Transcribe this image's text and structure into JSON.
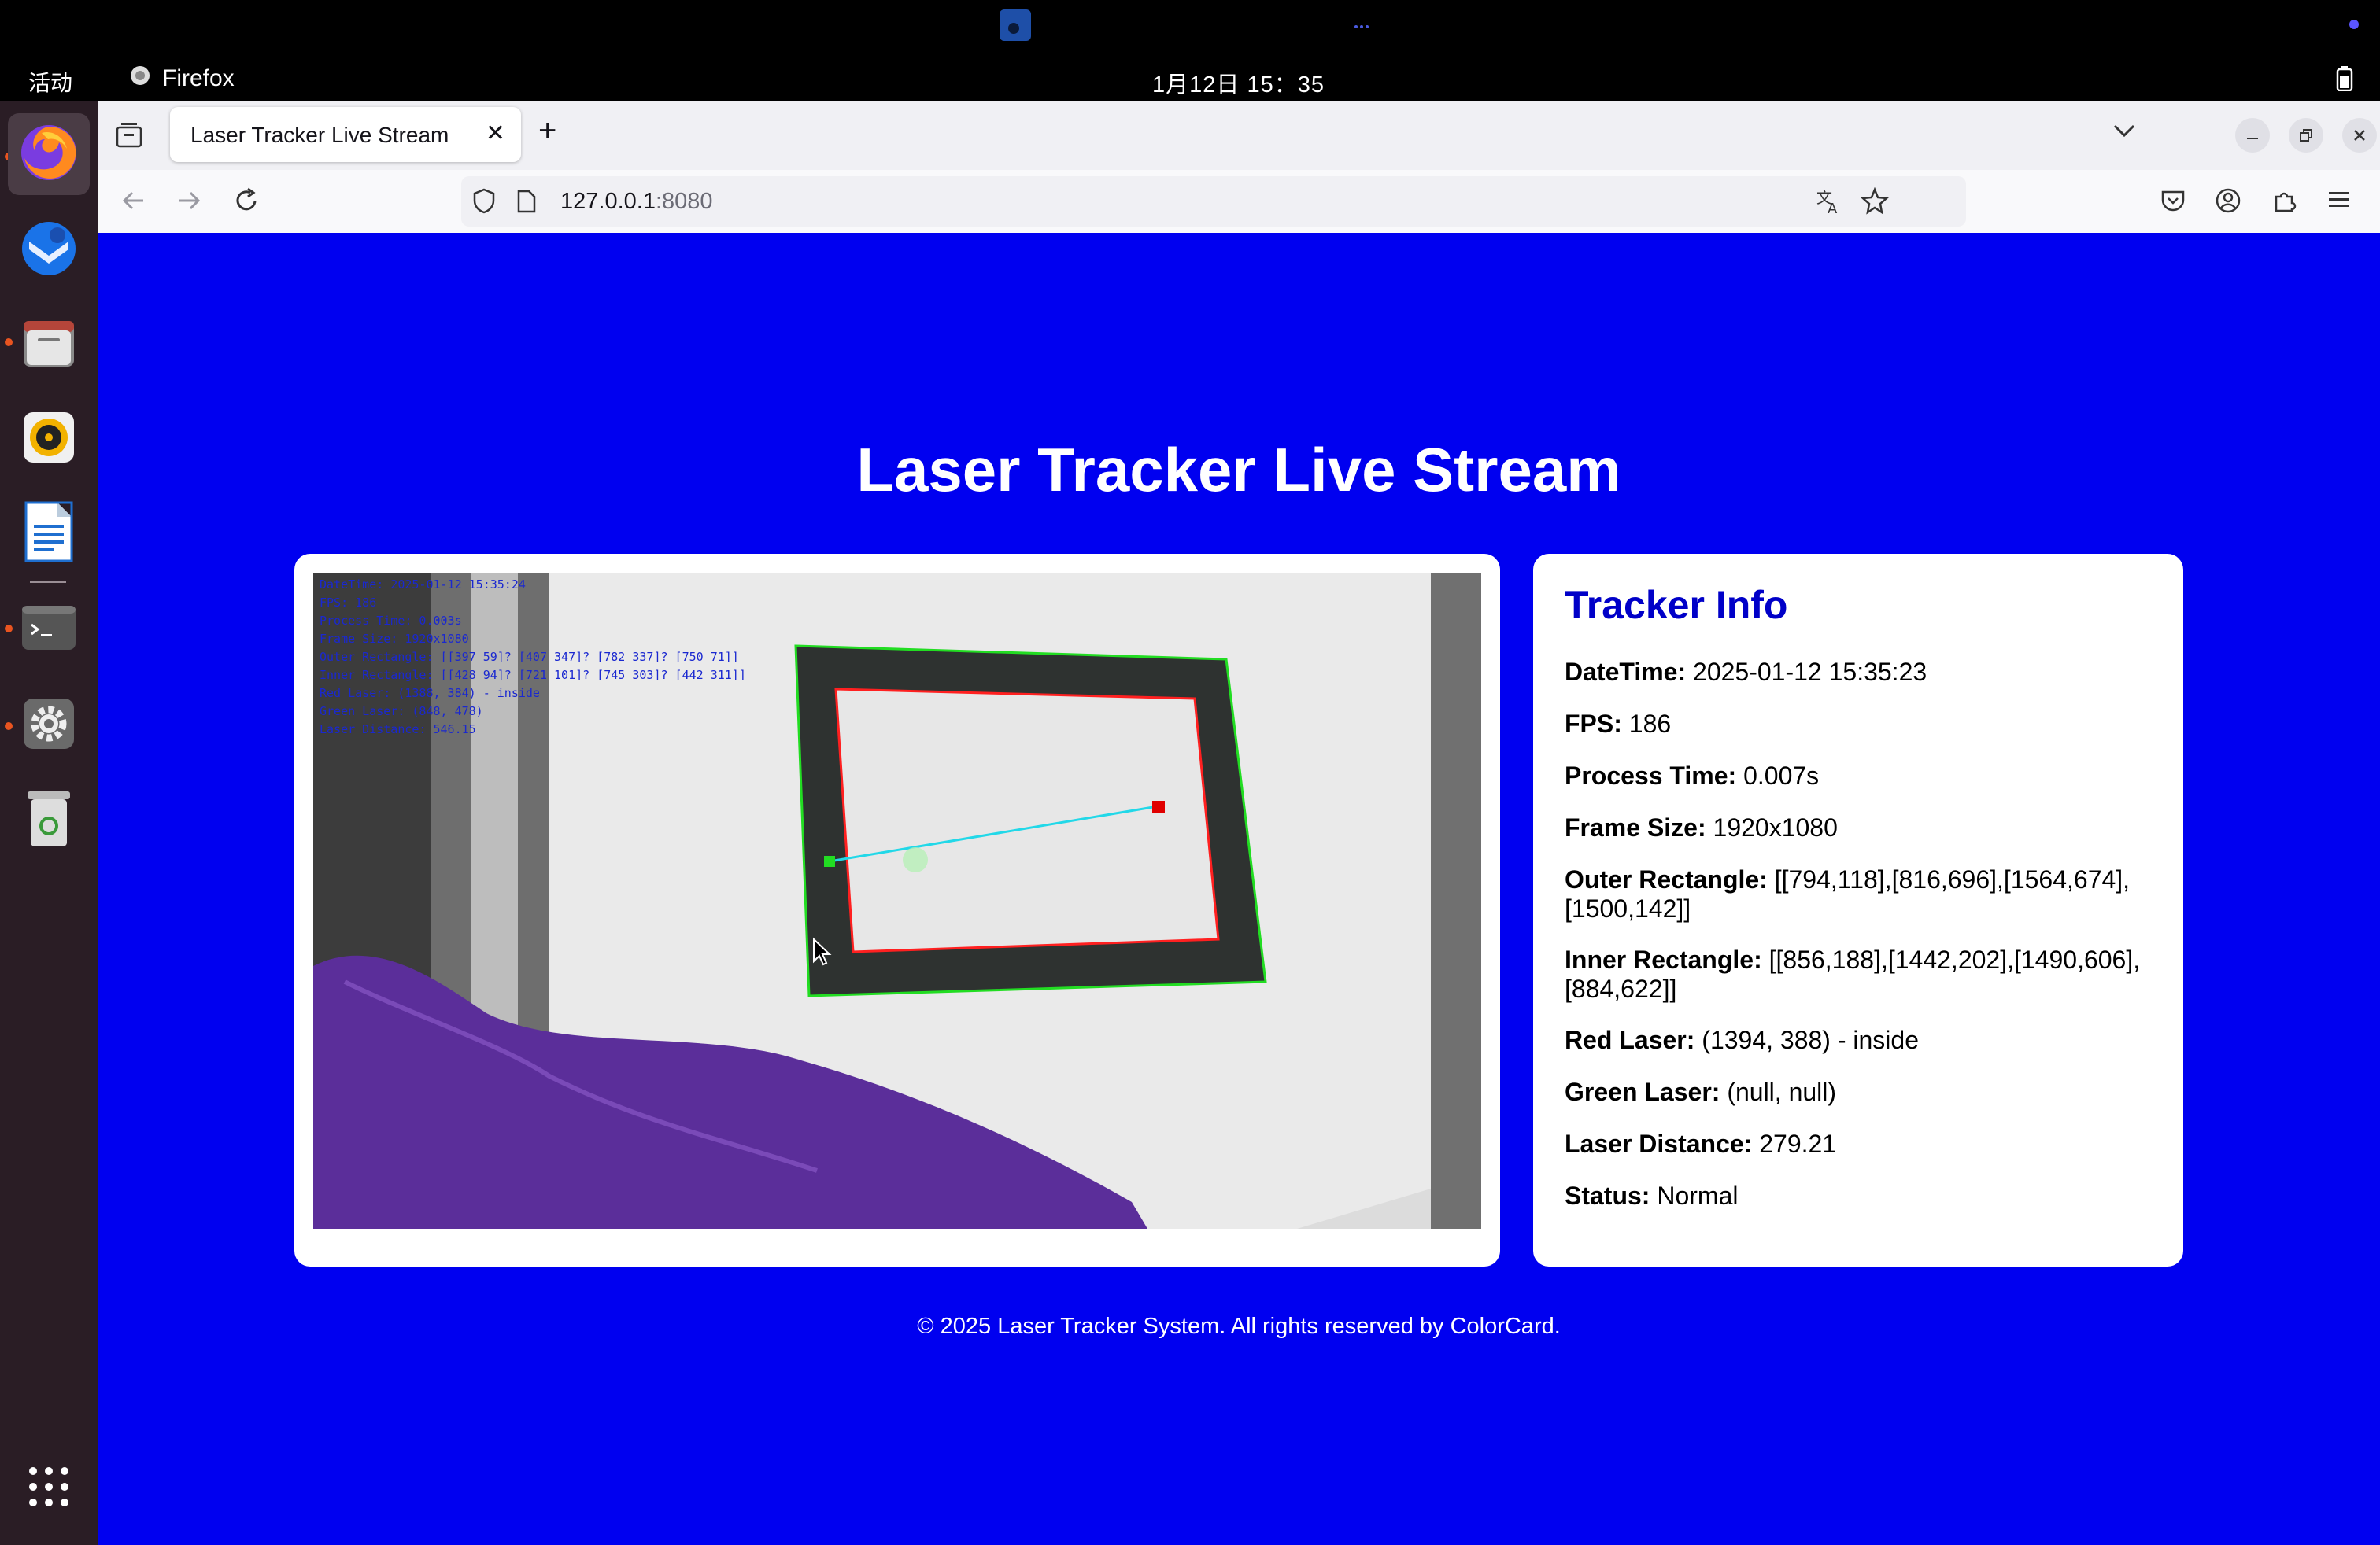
{
  "system": {
    "activities": "活动",
    "app_name": "Firefox",
    "clock": "1月12日 15：35"
  },
  "browser": {
    "tab_title": "Laser Tracker Live Stream",
    "url_host": "127.0.0.1",
    "url_port": ":8080"
  },
  "page": {
    "title": "Laser Tracker Live Stream",
    "footer": "© 2025 Laser Tracker System. All rights reserved by ColorCard."
  },
  "video_overlay": {
    "lines": [
      "DateTime: 2025-01-12 15:35:24",
      "FPS: 186",
      "Process Time: 0.003s",
      "Frame Size: 1920x1080",
      "Outer Rectangle: [[397  59]? [407 347]? [782 337]? [750  71]]",
      "Inner Rectangle: [[428  94]? [721 101]? [745 303]? [442 311]]",
      "Red Laser: (1388, 384) - inside",
      "Green Laser: (848, 478)",
      "Laser Distance: 546.15"
    ]
  },
  "tracker_info": {
    "title": "Tracker Info",
    "rows": [
      {
        "label": "DateTime:",
        "value": "2025-01-12 15:35:23"
      },
      {
        "label": "FPS:",
        "value": "186"
      },
      {
        "label": "Process Time:",
        "value": "0.007s"
      },
      {
        "label": "Frame Size:",
        "value": "1920x1080"
      },
      {
        "label": "Outer Rectangle:",
        "value": "[[794,118],[816,696],[1564,674],[1500,142]]"
      },
      {
        "label": "Inner Rectangle:",
        "value": "[[856,188],[1442,202],[1490,606],[884,622]]"
      },
      {
        "label": "Red Laser:",
        "value": "(1394, 388) - inside"
      },
      {
        "label": "Green Laser:",
        "value": "(null, null)"
      },
      {
        "label": "Laser Distance:",
        "value": "279.21"
      },
      {
        "label": "Status:",
        "value": "Normal"
      }
    ]
  },
  "colors": {
    "page_background": "#0000f0",
    "info_title": "#0000c8",
    "outer_rect": "#22dd22",
    "inner_rect": "#ff2020",
    "laser_line": "#22d8e8"
  }
}
